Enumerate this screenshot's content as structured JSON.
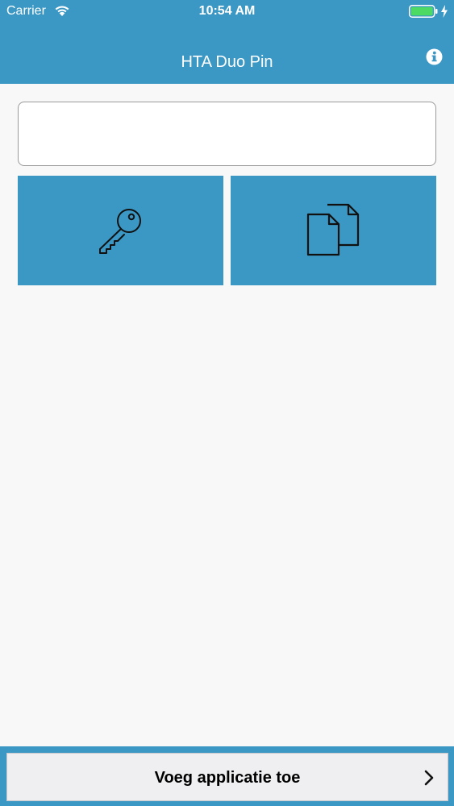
{
  "status_bar": {
    "carrier": "Carrier",
    "time": "10:54 AM"
  },
  "header": {
    "title": "HTA Duo Pin",
    "info_icon": "info-icon"
  },
  "input": {
    "value": "",
    "placeholder": ""
  },
  "actions": {
    "key_icon": "key-icon",
    "copy_icon": "copy-icon"
  },
  "footer": {
    "add_button_label": "Voeg applicatie toe",
    "chevron_icon": "chevron-right-icon"
  },
  "colors": {
    "brand": "#3b97c3",
    "background": "#f8f8f9",
    "battery": "#4cd964"
  }
}
